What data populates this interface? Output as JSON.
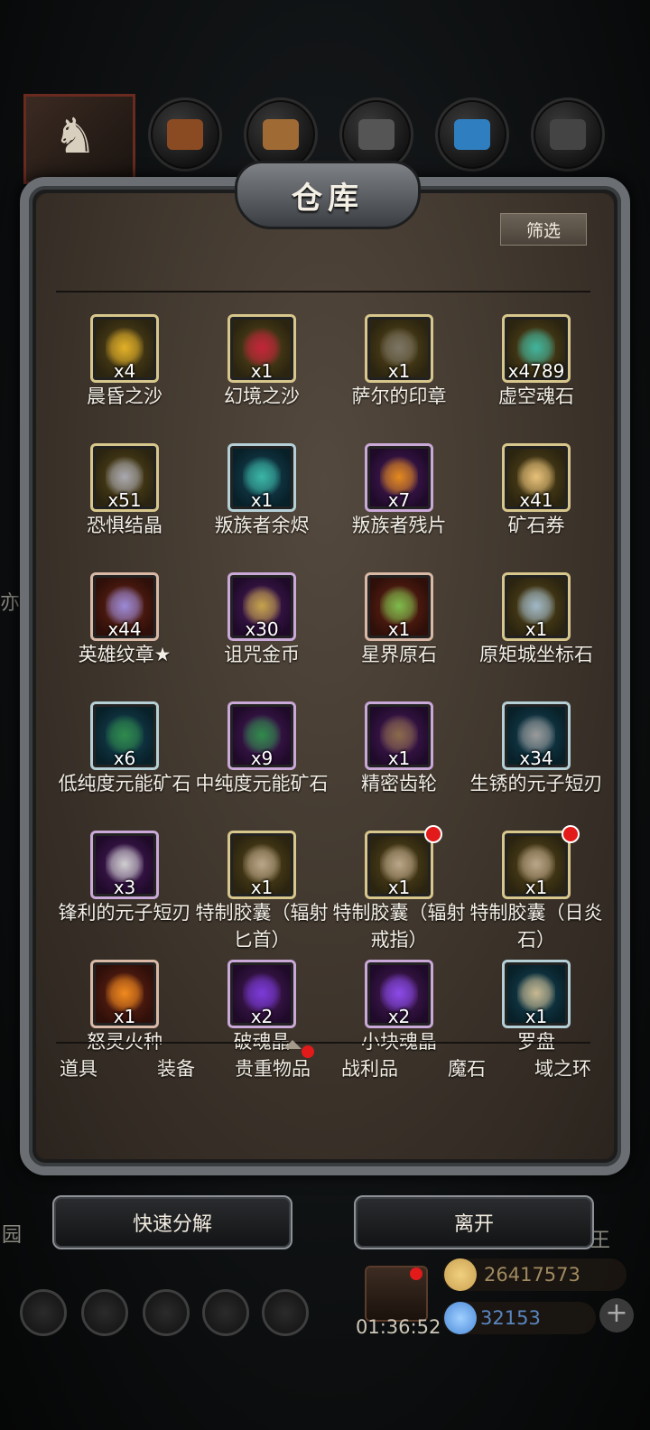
{
  "panel": {
    "title": "仓库",
    "filter_label": "筛选"
  },
  "items": [
    {
      "name": "晨昏之沙",
      "qty": "x4",
      "rarity": "gold",
      "icon": "golden-sand-icon",
      "color": "#e2b028"
    },
    {
      "name": "幻境之沙",
      "qty": "x1",
      "rarity": "gold",
      "icon": "red-sand-icon",
      "color": "#c4233a"
    },
    {
      "name": "萨尔的印章",
      "qty": "x1",
      "rarity": "gold",
      "icon": "armor-seal-icon",
      "color": "#7b7466"
    },
    {
      "name": "虚空魂石",
      "qty": "x4789",
      "rarity": "gold",
      "icon": "void-soul-stone-icon",
      "color": "#3fb59e"
    },
    {
      "name": "恐惧结晶",
      "qty": "x51",
      "rarity": "gold",
      "icon": "fear-crystal-icon",
      "color": "#a8a8b0"
    },
    {
      "name": "叛族者余烬",
      "qty": "x1",
      "rarity": "teal",
      "icon": "teal-ember-icon",
      "color": "#3bb6a5"
    },
    {
      "name": "叛族者残片",
      "qty": "x7",
      "rarity": "purple",
      "icon": "gold-shard-icon",
      "color": "#e28a1c"
    },
    {
      "name": "矿石券",
      "qty": "x41",
      "rarity": "gold",
      "icon": "ore-ticket-icon",
      "color": "#e6c07a"
    },
    {
      "name": "英雄纹章★",
      "qty": "x44",
      "rarity": "orange",
      "icon": "hero-crest-icon",
      "color": "#9a8ad8"
    },
    {
      "name": "诅咒金币",
      "qty": "x30",
      "rarity": "purple",
      "icon": "cursed-coin-icon",
      "color": "#c5a44a"
    },
    {
      "name": "星界原石",
      "qty": "x1",
      "rarity": "orange",
      "icon": "astral-ore-icon",
      "color": "#7dbb4c"
    },
    {
      "name": "原矩城坐标石",
      "qty": "x1",
      "rarity": "gold",
      "icon": "coordinate-cube-icon",
      "color": "#9fb8c8"
    },
    {
      "name": "低纯度元能矿石",
      "qty": "x6",
      "rarity": "teal",
      "icon": "green-ore-icon",
      "color": "#2f8a4a"
    },
    {
      "name": "中纯度元能矿石",
      "qty": "x9",
      "rarity": "purple",
      "icon": "green-ore-icon",
      "color": "#2f8a4a"
    },
    {
      "name": "精密齿轮",
      "qty": "x1",
      "rarity": "purple",
      "icon": "gear-icon",
      "color": "#8a6a4a"
    },
    {
      "name": "生锈的元子短刃",
      "qty": "x34",
      "rarity": "teal",
      "icon": "rusty-blade-icon",
      "color": "#9a9a9a"
    },
    {
      "name": "锋利的元子短刃",
      "qty": "x3",
      "rarity": "purple",
      "icon": "sharp-blade-icon",
      "color": "#cfcfcf"
    },
    {
      "name": "特制胶囊（辐射匕首）",
      "qty": "x1",
      "rarity": "gold",
      "icon": "capsule-icon",
      "color": "#b9a58a",
      "dot": false
    },
    {
      "name": "特制胶囊（辐射戒指）",
      "qty": "x1",
      "rarity": "gold",
      "icon": "capsule-icon",
      "color": "#b9a58a",
      "dot": true
    },
    {
      "name": "特制胶囊（日炎石）",
      "qty": "x1",
      "rarity": "gold",
      "icon": "capsule-icon",
      "color": "#b9a58a",
      "dot": true
    },
    {
      "name": "怒灵火种",
      "qty": "x1",
      "rarity": "orange",
      "icon": "fire-seed-icon",
      "color": "#f08a1e"
    },
    {
      "name": "破魂晶",
      "qty": "x2",
      "rarity": "purple",
      "icon": "purple-crystal-icon",
      "color": "#7a3ad8"
    },
    {
      "name": "小块魂晶",
      "qty": "x2",
      "rarity": "purple",
      "icon": "purple-crystal-icon",
      "color": "#8a4ae8"
    },
    {
      "name": "罗盘",
      "qty": "x1",
      "rarity": "teal",
      "icon": "compass-icon",
      "color": "#c8b890"
    }
  ],
  "tabs": [
    {
      "label": "道具"
    },
    {
      "label": "装备"
    },
    {
      "label": "贵重物品",
      "dot": true
    },
    {
      "label": "战利品"
    },
    {
      "label": "魔石"
    },
    {
      "label": "域之环"
    }
  ],
  "actions": {
    "decompose_label": "快速分解",
    "leave_label": "离开"
  },
  "hud": {
    "timer": "01:36:52",
    "gold": "26417573",
    "gems": "32153",
    "gold_color": "#c8a050",
    "gem_color": "#4a88d8"
  },
  "side_hints": {
    "left_upper": "亦",
    "left_lower": "园",
    "right_lower": "王"
  }
}
